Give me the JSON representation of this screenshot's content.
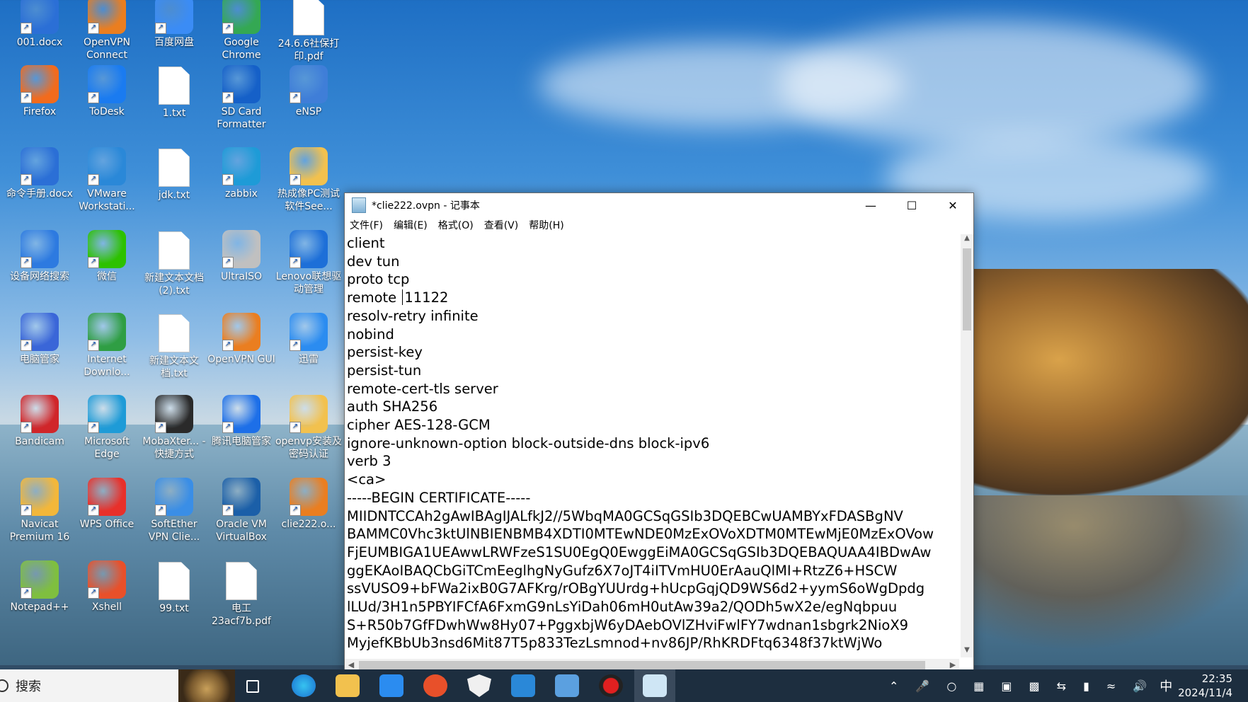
{
  "desktop": {
    "icons": [
      {
        "label": "001.docx",
        "icon": "word-doc-icon",
        "color": "#2b6fd6"
      },
      {
        "label": "OpenVPN Connect",
        "icon": "openvpn-icon",
        "color": "#ea7e20"
      },
      {
        "label": "百度网盘",
        "icon": "baidu-netdisk-icon",
        "color": "#3b8cf5"
      },
      {
        "label": "Google Chrome",
        "icon": "chrome-icon",
        "color": "#34a853"
      },
      {
        "label": "24.6.6社保打印.pdf",
        "icon": "pdf-file-icon",
        "color": "#ffffff"
      },
      {
        "label": "Firefox",
        "icon": "firefox-icon",
        "color": "#f26b1d"
      },
      {
        "label": "ToDesk",
        "icon": "todesk-icon",
        "color": "#1a7bf0"
      },
      {
        "label": "1.txt",
        "icon": "text-file-icon",
        "color": "#ffffff"
      },
      {
        "label": "SD Card Formatter",
        "icon": "sd-card-icon",
        "color": "#1560c8"
      },
      {
        "label": "eNSP",
        "icon": "ensp-icon",
        "color": "#3f7ed8"
      },
      {
        "label": "命令手册.docx",
        "icon": "word-doc-icon",
        "color": "#2b6fd6"
      },
      {
        "label": "VMware Workstati...",
        "icon": "vmware-icon",
        "color": "#2a88d8"
      },
      {
        "label": "jdk.txt",
        "icon": "text-file-icon",
        "color": "#ffffff"
      },
      {
        "label": "zabbix",
        "icon": "edge-icon",
        "color": "#1e9bd7"
      },
      {
        "label": "热成像PC测试软件See...",
        "icon": "folder-icon",
        "color": "#f2c14e"
      },
      {
        "label": "设备网络搜索",
        "icon": "network-search-icon",
        "color": "#2d7ae0"
      },
      {
        "label": "微信",
        "icon": "wechat-icon",
        "color": "#2dc100"
      },
      {
        "label": "新建文本文档 (2).txt",
        "icon": "text-file-icon",
        "color": "#ffffff"
      },
      {
        "label": "UltraISO",
        "icon": "ultraiso-icon",
        "color": "#c0c0c0"
      },
      {
        "label": "Lenovo联想驱动管理",
        "icon": "lenovo-driver-icon",
        "color": "#1d6fd8"
      },
      {
        "label": "电脑管家",
        "icon": "pc-manager-icon",
        "color": "#3a66d8"
      },
      {
        "label": "Internet Downlo...",
        "icon": "idm-icon",
        "color": "#2f9e44"
      },
      {
        "label": "新建文本文档.txt",
        "icon": "text-file-icon",
        "color": "#ffffff"
      },
      {
        "label": "OpenVPN GUI",
        "icon": "openvpn-icon",
        "color": "#ea7e20"
      },
      {
        "label": "迅雷",
        "icon": "xunlei-icon",
        "color": "#2b8cf0"
      },
      {
        "label": "Bandicam",
        "icon": "bandicam-icon",
        "color": "#d0262a"
      },
      {
        "label": "Microsoft Edge",
        "icon": "edge-icon",
        "color": "#1e9bd7"
      },
      {
        "label": "MobaXter... - 快捷方式",
        "icon": "mobaxterm-icon",
        "color": "#2a2a2a"
      },
      {
        "label": "腾讯电脑管家",
        "icon": "tencent-manager-icon",
        "color": "#1d6fe8"
      },
      {
        "label": "openvp安装及密码认证",
        "icon": "folder-icon",
        "color": "#f2c14e"
      },
      {
        "label": "Navicat Premium 16",
        "icon": "navicat-icon",
        "color": "#f3b73a"
      },
      {
        "label": "WPS Office",
        "icon": "wps-icon",
        "color": "#e8302a"
      },
      {
        "label": "SoftEther VPN Clie...",
        "icon": "softether-icon",
        "color": "#3a8ee6"
      },
      {
        "label": "Oracle VM VirtualBox",
        "icon": "virtualbox-icon",
        "color": "#1b5fa8"
      },
      {
        "label": "clie222.o...",
        "icon": "openvpn-config-icon",
        "color": "#ea7e20"
      },
      {
        "label": "Notepad++",
        "icon": "notepadpp-icon",
        "color": "#7fbf3f"
      },
      {
        "label": "Xshell",
        "icon": "xshell-icon",
        "color": "#e8502a"
      },
      {
        "label": "99.txt",
        "icon": "text-file-icon",
        "color": "#ffffff"
      },
      {
        "label": "电工23acf7b.pdf",
        "icon": "pdf-file-icon",
        "color": "#ffffff"
      }
    ]
  },
  "notepad": {
    "title": "*clie222.ovpn - 记事本",
    "menu": [
      "文件(F)",
      "编辑(E)",
      "格式(O)",
      "查看(V)",
      "帮助(H)"
    ],
    "lines": [
      "client",
      "dev tun",
      "proto tcp",
      "remote",
      "resolv-retry infinite",
      "nobind",
      "persist-key",
      "persist-tun",
      "remote-cert-tls server",
      "auth SHA256",
      "cipher AES-128-GCM",
      "ignore-unknown-option block-outside-dns block-ipv6",
      "verb 3",
      "<ca>",
      "-----BEGIN CERTIFICATE-----",
      "MIIDNTCCAh2gAwIBAgIJALfkJ2//5WbqMA0GCSqGSIb3DQEBCwUAMBYxFDASBgNV",
      "BAMMC0Vhc3ktUlNBIENBMB4XDTI0MTEwNDE0MzExOVoXDTM0MTEwMjE0MzExOVow",
      "FjEUMBIGA1UEAwwLRWFzeS1SU0EgQ0EwggEiMA0GCSqGSIb3DQEBAQUAA4IBDwAw",
      "ggEKAoIBAQCbGiTCmEeglhgNyGufz6X7oJT4iITVmHU0ErAauQlMI+RtzZ6+HSCW",
      "ssVUSO9+bFWa2ixB0G7AFKrg/rOBgYUUrdg+hUcpGqjQD9WS6d2+yymS6oWgDpdg",
      "lLUd/3H1n5PBYIFCfA6FxmG9nLsYiDah06mH0utAw39a2/QODh5wX2e/egNqbpuu",
      "S+R50b7GfFDwhWw8Hy07+PggxbjW6yDAebOVlZHviFwlFY7wdnan1sbgrk2NioX9",
      "MyjefKBbUb3nsd6Mit87T5p833TezLsmnod+nv86JP/RhKRDFtq6348f37ktWjWo"
    ],
    "remote_port": "11122"
  },
  "taskbar": {
    "search_placeholder": "搜索",
    "ime": "中",
    "time": "22:35",
    "date": "2024/11/4"
  }
}
